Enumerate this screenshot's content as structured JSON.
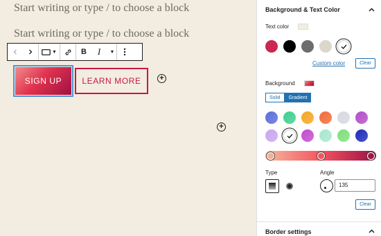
{
  "editor": {
    "placeholder_1": "Start writing or type / to choose a block",
    "placeholder_2": "Start writing or type / to choose a block",
    "toolbar": {
      "prev_icon": "chevron-left-icon",
      "next_icon": "chevron-right-icon",
      "block_icon": "button-block-icon",
      "link_icon": "link-icon",
      "bold_label": "B",
      "italic_label": "I",
      "more_icon": "more-vertical-icon"
    },
    "buttons": {
      "signup_label": "SIGN UP",
      "learn_more_label": "LEARN MORE"
    },
    "add_block_icon": "plus-circle-icon"
  },
  "sidebar": {
    "color_panel_title": "Background & Text Color",
    "text_color_label": "Text color",
    "text_color_value": "#f3ece0",
    "text_palette": [
      {
        "color": "#cd2653"
      },
      {
        "color": "#000000"
      },
      {
        "color": "#6d6d6d"
      },
      {
        "color": "#dcd7ca"
      },
      {
        "color": "#ffffff",
        "selected": true
      }
    ],
    "custom_color_link": "Custom color",
    "clear_label": "Clear",
    "background_label": "Background",
    "background_preview": "#e0334f",
    "tabs": {
      "solid": "Solid",
      "gradient": "Gradient",
      "active": "gradient"
    },
    "gradient_palette": [
      {
        "color": "#5b6cd9"
      },
      {
        "color": "#3ecf8e"
      },
      {
        "color": "#f5a623"
      },
      {
        "color": "#f26b38"
      },
      {
        "color": "#d5d9e0"
      },
      {
        "color": "#b14ec7"
      },
      {
        "color": "#c8a6f0"
      },
      {
        "color": "#ffffff",
        "selected": true
      },
      {
        "color": "#c34bd0"
      },
      {
        "color": "#a8e6cf"
      },
      {
        "color": "#7ee07a"
      },
      {
        "color": "#1d2bb8"
      }
    ],
    "gradient_stops": [
      "#f7b79b",
      "#f25561",
      "#9c0f44"
    ],
    "type_label": "Type",
    "angle_label": "Angle",
    "angle_value": "135",
    "clear_label_2": "Clear",
    "border_panel_title": "Border settings"
  }
}
